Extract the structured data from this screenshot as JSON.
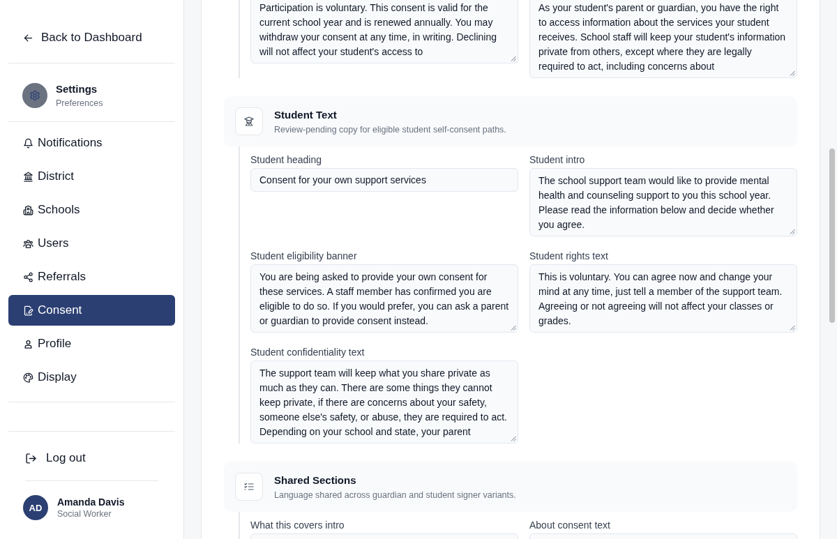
{
  "sidebar": {
    "back_link": "Back to Dashboard",
    "header": {
      "title": "Settings",
      "subtitle": "Preferences"
    },
    "items": [
      {
        "label": "Notifications",
        "selected": false
      },
      {
        "label": "District",
        "selected": false
      },
      {
        "label": "Schools",
        "selected": false
      },
      {
        "label": "Users",
        "selected": false
      },
      {
        "label": "Referrals",
        "selected": false
      },
      {
        "label": "Consent",
        "selected": true
      },
      {
        "label": "Profile",
        "selected": false
      },
      {
        "label": "Display",
        "selected": false
      }
    ],
    "logout": "Log out",
    "user": {
      "initials": "AD",
      "name": "Amanda Davis",
      "role": "Social Worker"
    }
  },
  "sections": [
    {
      "fields": [
        {
          "kind": "textarea",
          "value": "Participation is voluntary. This consent is valid for the current school year and is renewed annually. You may withdraw your consent at any time, in writing. Declining will not affect your student's access to"
        },
        {
          "kind": "textarea",
          "value": "As your student's parent or guardian, you have the right to access information about the services your student receives. School staff will keep your student's information private from others, except where they are legally required to act, including concerns about"
        }
      ]
    },
    {
      "title": "Student Text",
      "subtitle": "Review-pending copy for eligible student self-consent paths.",
      "fields": [
        {
          "label": "Student heading",
          "kind": "input",
          "value": "Consent for your own support services"
        },
        {
          "label": "Student intro",
          "kind": "textarea",
          "value": "The school support team would like to provide mental health and counseling support to you this school year. Please read the information below and decide whether you agree."
        },
        {
          "label": "Student eligibility banner",
          "kind": "textarea",
          "value": "You are being asked to provide your own consent for these services. A staff member has confirmed you are eligible to do so. If you would prefer, you can ask a parent or guardian to provide consent instead."
        },
        {
          "label": "Student rights text",
          "kind": "textarea",
          "value": "This is voluntary. You can agree now and change your mind at any time, just tell a member of the support team. Agreeing or not agreeing will not affect your classes or grades."
        },
        {
          "label": "Student confidentiality text",
          "kind": "textarea",
          "value": "The support team will keep what you share private as much as they can. There are some things they cannot keep private, if there are concerns about your safety, someone else's safety, or abuse, they are required to act. Depending on your school and state, your parent"
        }
      ]
    },
    {
      "title": "Shared Sections",
      "subtitle": "Language shared across guardian and student signer variants.",
      "fields": [
        {
          "label": "What this covers intro",
          "kind": "textarea"
        },
        {
          "label": "About consent text",
          "kind": "textarea"
        }
      ]
    }
  ]
}
